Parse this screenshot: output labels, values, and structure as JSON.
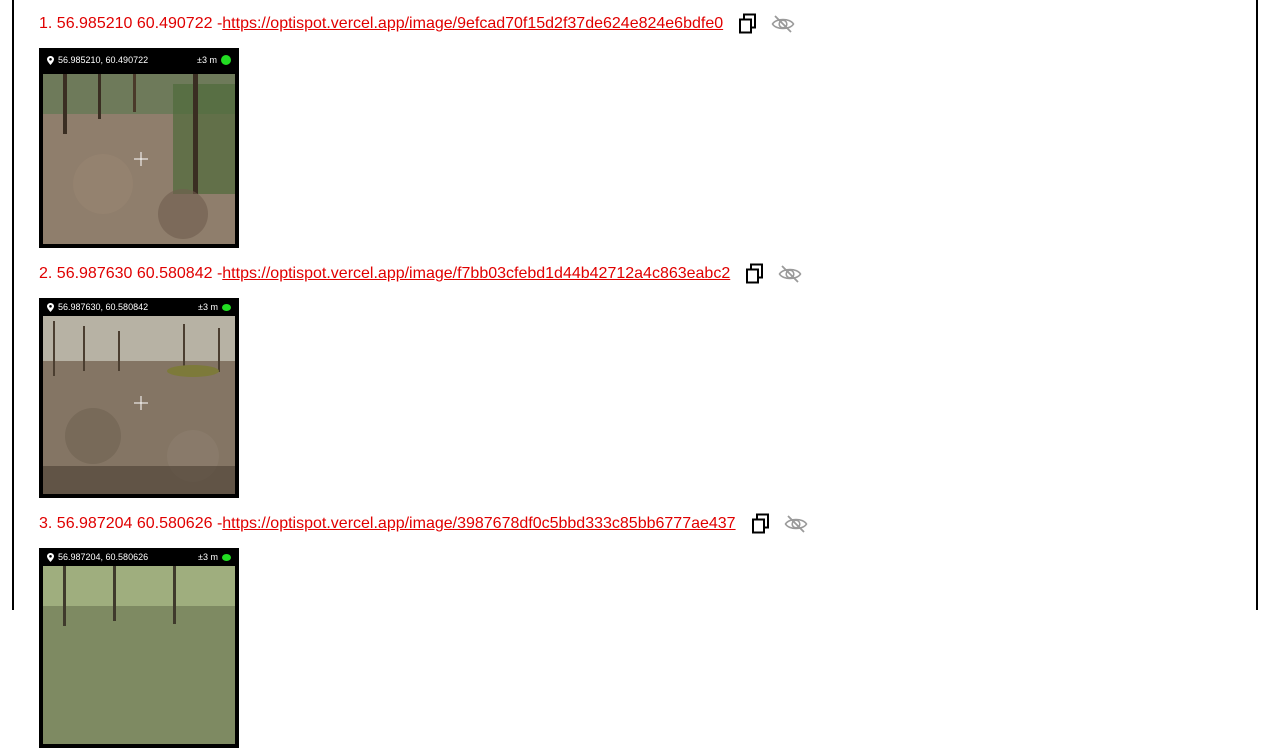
{
  "entries": [
    {
      "prefix": "1. 56.985210 60.490722 - ",
      "url": "https://optispot.vercel.app/image/9efcad70f15d2f37de624e824e6bdfe0",
      "overlay_coords": "56.985210, 60.490722",
      "overlay_accuracy": "±3 m"
    },
    {
      "prefix": "2. 56.987630 60.580842 - ",
      "url": "https://optispot.vercel.app/image/f7bb03cfebd1d44b42712a4c863eabc2",
      "overlay_coords": "56.987630, 60.580842",
      "overlay_accuracy": "±3 m"
    },
    {
      "prefix": "3. 56.987204 60.580626 - ",
      "url": "https://optispot.vercel.app/image/3987678df0c5bbd333c85bb6777ae437",
      "overlay_coords": "56.987204, 60.580626",
      "overlay_accuracy": "±3 m"
    }
  ],
  "icons": {
    "copy": "copy-icon",
    "hide": "eye-slash-icon",
    "pin": "map-pin-icon"
  },
  "colors": {
    "text": "#e00000",
    "accuracy_dot": "#22dd22",
    "eye_icon": "#9a9a9a"
  }
}
